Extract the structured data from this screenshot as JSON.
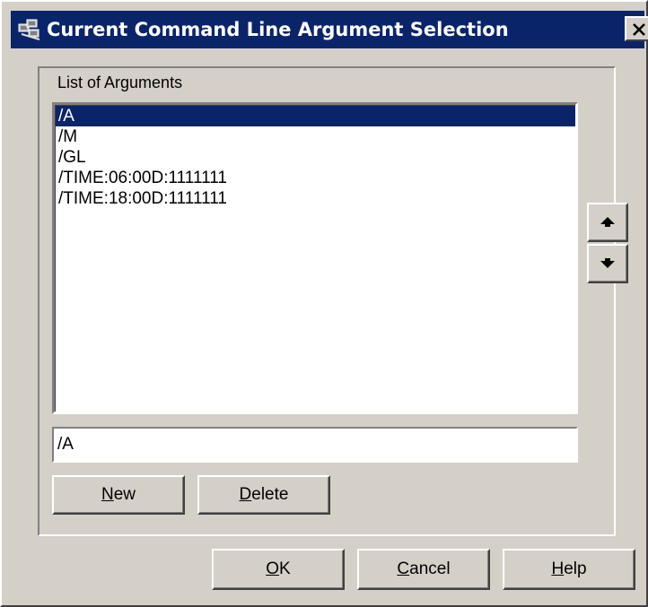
{
  "window": {
    "title": "Current Command Line Argument Selection",
    "app_icon": "network-computers-icon",
    "close_icon": "close-icon"
  },
  "group": {
    "label": "List of Arguments"
  },
  "arguments": {
    "items": [
      "/A",
      "/M",
      "/GL",
      "/TIME:06:00D:1111111",
      "/TIME:18:00D:1111111"
    ],
    "selected_index": 0
  },
  "edit_field": {
    "value": "/A"
  },
  "buttons": {
    "new": {
      "mnemonic": "N",
      "rest": "ew"
    },
    "delete": {
      "mnemonic": "D",
      "rest": "elete"
    },
    "ok": {
      "mnemonic": "O",
      "rest": "K"
    },
    "cancel": {
      "mnemonic": "C",
      "rest": "ancel"
    },
    "help": {
      "mnemonic": "H",
      "rest": "elp"
    },
    "move_up_icon": "arrow-up-icon",
    "move_down_icon": "arrow-down-icon"
  },
  "colors": {
    "title_bar": "#0a246a",
    "face": "#d4d0c8",
    "selection": "#0a246a"
  }
}
